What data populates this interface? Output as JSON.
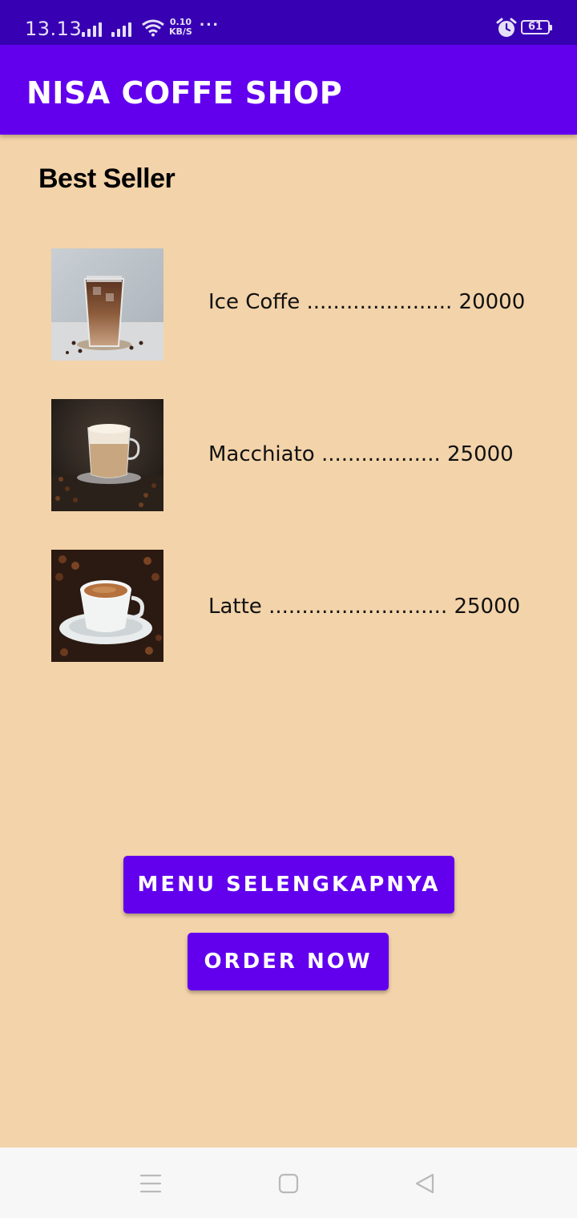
{
  "status": {
    "time": "13.13",
    "speed_value": "0.10",
    "speed_unit": "KB/S",
    "battery": "61",
    "icons": [
      "signal-icon",
      "signal-icon",
      "wifi-icon",
      "more-dots-icon",
      "alarm-icon",
      "battery-icon"
    ]
  },
  "app_bar": {
    "title": "NISA COFFE SHOP"
  },
  "main": {
    "section_title": "Best Seller",
    "items": [
      {
        "text": "Ice Coffe ...................... 20000",
        "image": "ice-coffee-image"
      },
      {
        "text": "Macchiato .................. 25000",
        "image": "macchiato-image"
      },
      {
        "text": "Latte ........................... 25000",
        "image": "latte-image"
      }
    ]
  },
  "buttons": {
    "menu": "MENU SELENGKAPNYA",
    "order": "ORDER NOW"
  },
  "colors": {
    "primary": "#6200ee",
    "status_bar": "#3700b3",
    "background": "#f3d3a9"
  },
  "nav": {
    "icons": [
      "recent-apps-icon",
      "home-icon",
      "back-icon"
    ]
  }
}
